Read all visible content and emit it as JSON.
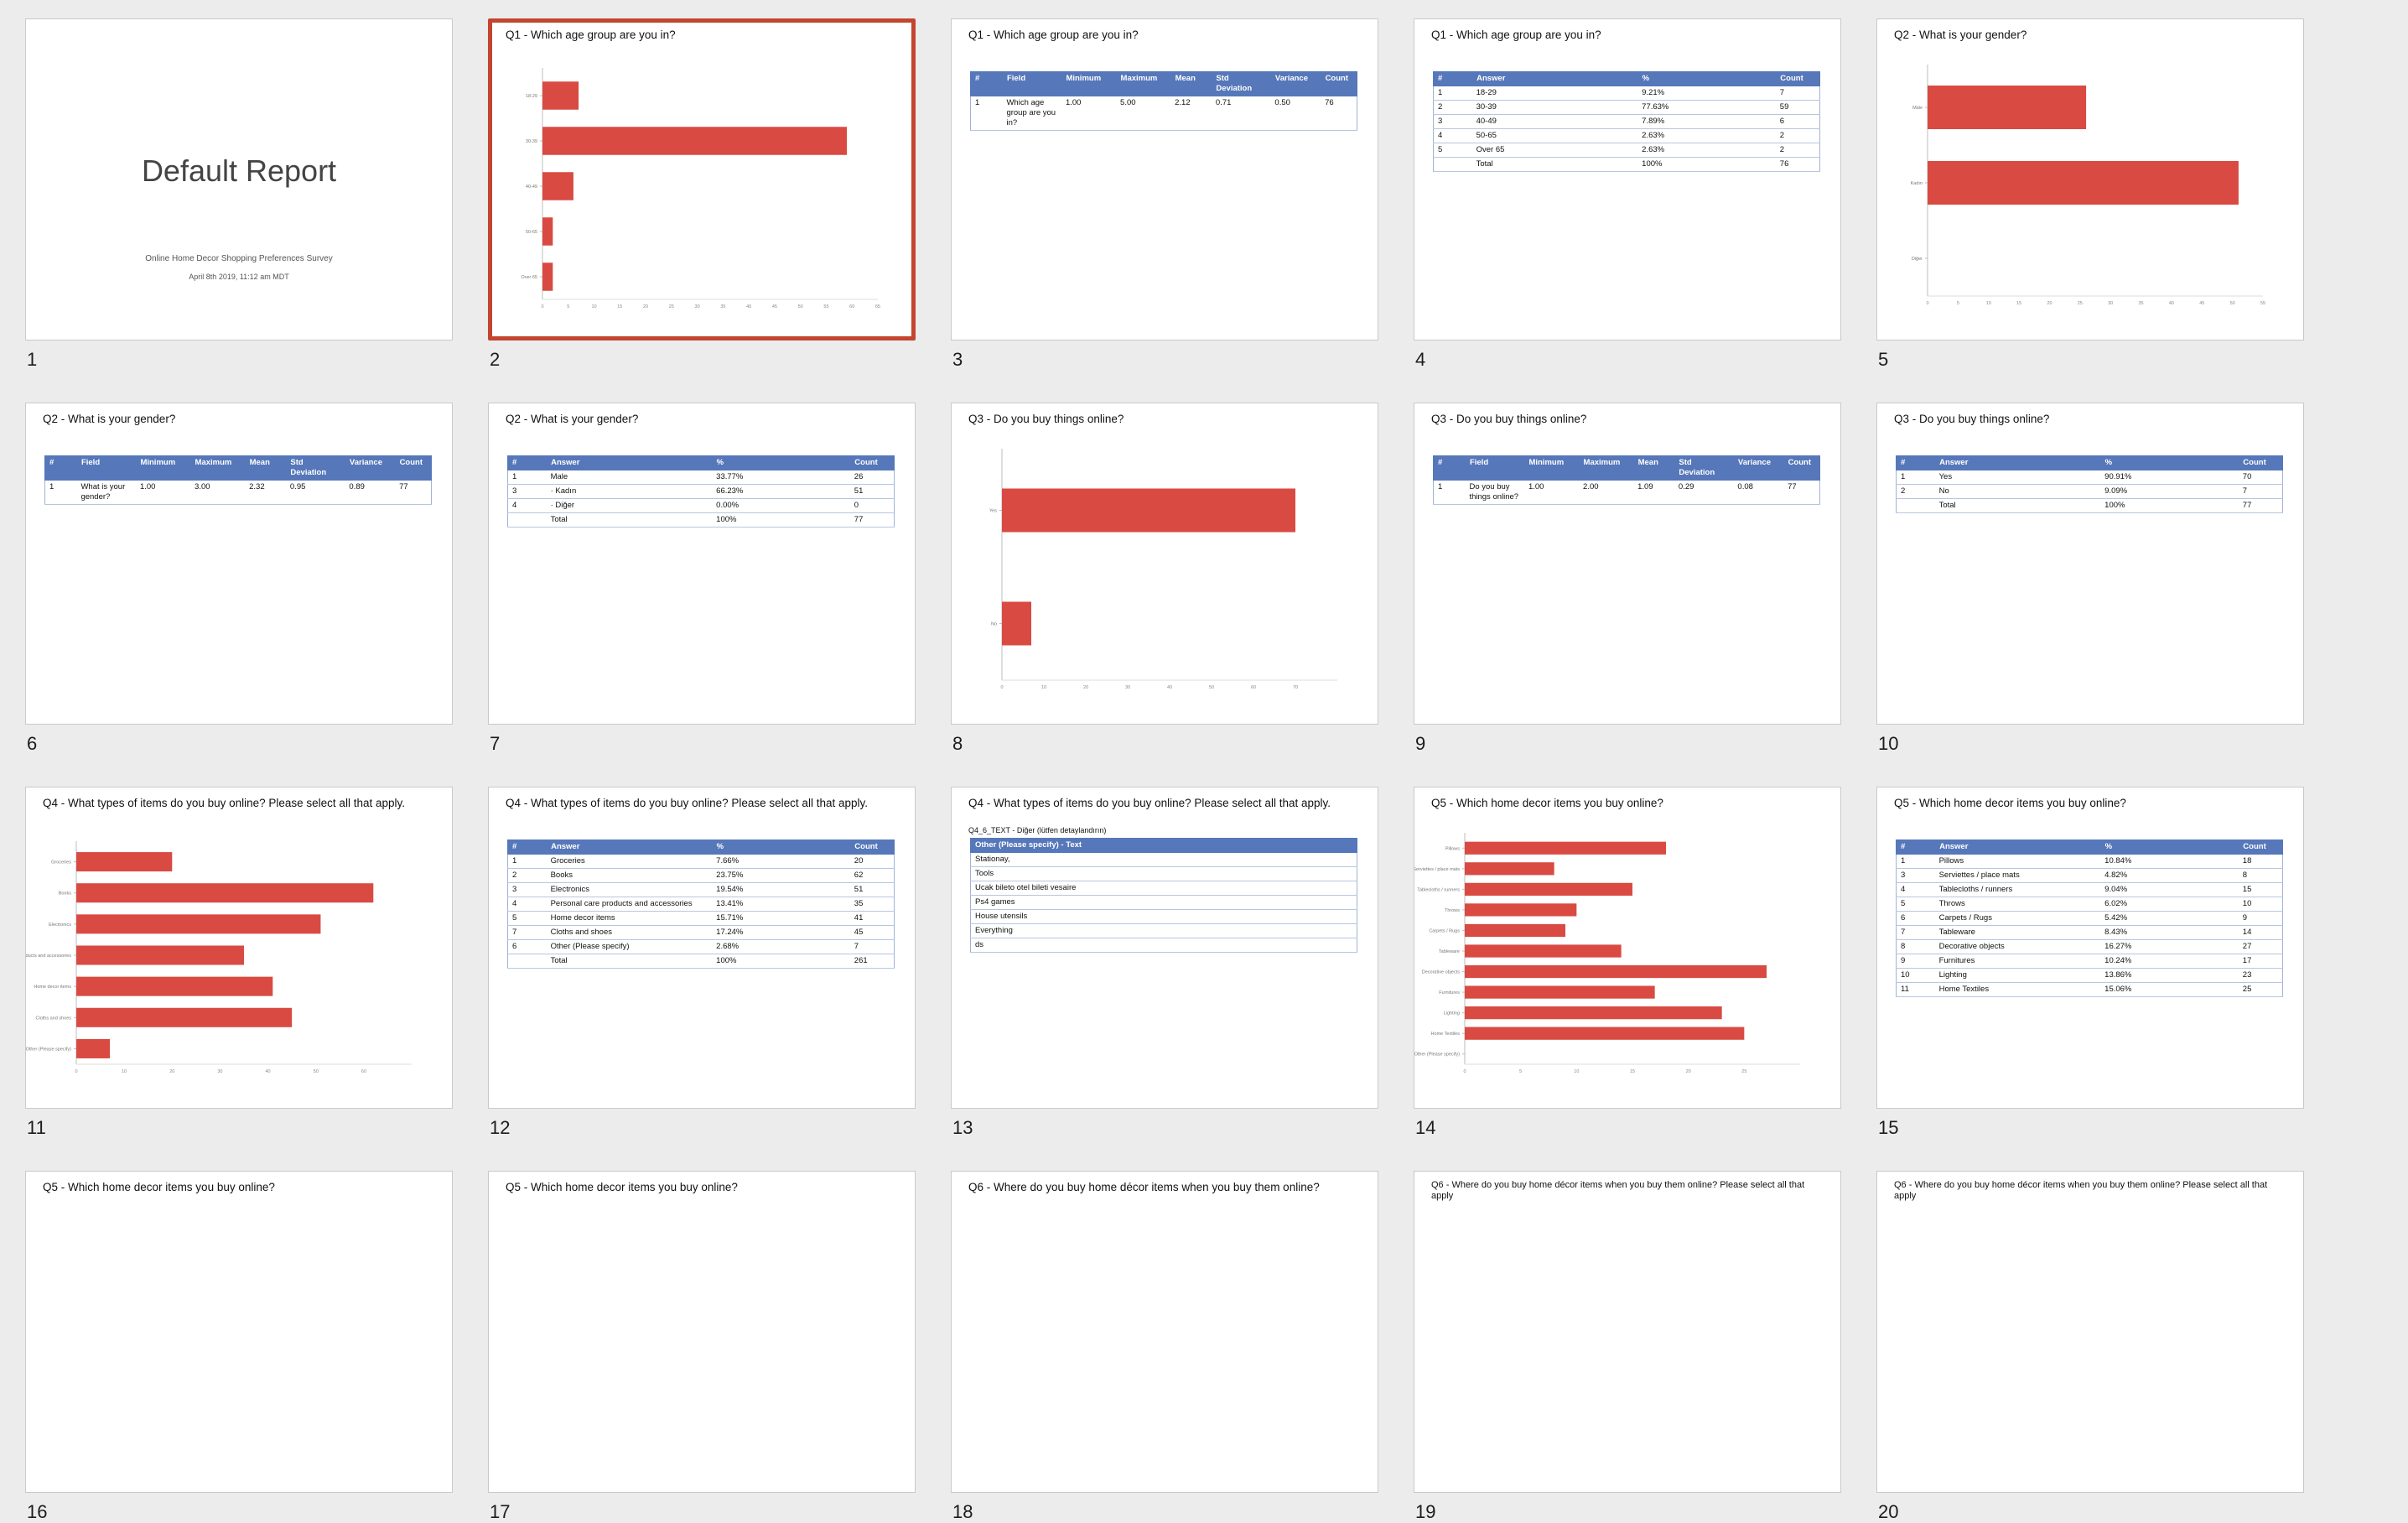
{
  "accent": "#c4452f",
  "table_header_color": "#5677b9",
  "bar_color": "#d94a42",
  "slides": [
    {
      "number": "1",
      "type": "cover",
      "title": "Default Report",
      "survey": "Online Home Decor Shopping Preferences Survey",
      "date": "April 8th 2019, 11:12 am MDT"
    },
    {
      "number": "2",
      "type": "chart",
      "selected": true,
      "title": "Q1 - Which age group are you in?",
      "chart_data": {
        "type": "bar",
        "orientation": "horizontal",
        "categories": [
          "18-29",
          "30-39",
          "40-49",
          "50-65",
          "Over 65"
        ],
        "values": [
          7,
          59,
          6,
          2,
          2
        ],
        "xlim": [
          0,
          65
        ],
        "ticks": [
          "0",
          "5",
          "10",
          "15",
          "20",
          "25",
          "30",
          "35",
          "40",
          "45",
          "50",
          "55",
          "60",
          "65"
        ]
      }
    },
    {
      "number": "3",
      "type": "table",
      "title": "Q1 - Which age group are you in?",
      "table": {
        "headers": [
          "#",
          "Field",
          "Minimum",
          "Maximum",
          "Mean",
          "Std Deviation",
          "Variance",
          "Count"
        ],
        "rows": [
          [
            "1",
            "Which age group are you in?",
            "1.00",
            "5.00",
            "2.12",
            "0.71",
            "0.50",
            "76"
          ]
        ]
      }
    },
    {
      "number": "4",
      "type": "table",
      "title": "Q1 - Which age group are you in?",
      "table": {
        "headers": [
          "#",
          "Answer",
          "%",
          "Count"
        ],
        "rows": [
          [
            "1",
            "18-29",
            "9.21%",
            "7"
          ],
          [
            "2",
            "30-39",
            "77.63%",
            "59"
          ],
          [
            "3",
            "40-49",
            "7.89%",
            "6"
          ],
          [
            "4",
            "50-65",
            "2.63%",
            "2"
          ],
          [
            "5",
            "Over 65",
            "2.63%",
            "2"
          ],
          [
            "",
            "Total",
            "100%",
            "76"
          ]
        ]
      }
    },
    {
      "number": "5",
      "type": "chart",
      "title": "Q2 - What is your gender?",
      "chart_data": {
        "type": "bar",
        "orientation": "horizontal",
        "categories": [
          "Male",
          "Kadın",
          "Diğer"
        ],
        "values": [
          26,
          51,
          0
        ],
        "xlim": [
          0,
          55
        ],
        "ticks": [
          "0",
          "5",
          "10",
          "15",
          "20",
          "25",
          "30",
          "35",
          "40",
          "45",
          "50",
          "55"
        ]
      }
    },
    {
      "number": "6",
      "type": "table",
      "title": "Q2 - What is your gender?",
      "table": {
        "headers": [
          "#",
          "Field",
          "Minimum",
          "Maximum",
          "Mean",
          "Std Deviation",
          "Variance",
          "Count"
        ],
        "rows": [
          [
            "1",
            "What is your gender?",
            "1.00",
            "3.00",
            "2.32",
            "0.95",
            "0.89",
            "77"
          ]
        ]
      }
    },
    {
      "number": "7",
      "type": "table",
      "title": "Q2 - What is your gender?",
      "table": {
        "headers": [
          "#",
          "Answer",
          "%",
          "Count"
        ],
        "rows": [
          [
            "1",
            "Male",
            "33.77%",
            "26"
          ],
          [
            "3",
            "· Kadın",
            "66.23%",
            "51"
          ],
          [
            "4",
            "· Diğer",
            "0.00%",
            "0"
          ],
          [
            "",
            "Total",
            "100%",
            "77"
          ]
        ]
      }
    },
    {
      "number": "8",
      "type": "chart",
      "title": "Q3 - Do you buy things online?",
      "chart_data": {
        "type": "bar",
        "orientation": "horizontal",
        "categories": [
          "Yes",
          "No"
        ],
        "values": [
          70,
          7
        ],
        "xlim": [
          0,
          80
        ],
        "ticks": [
          "0",
          "10",
          "20",
          "30",
          "40",
          "50",
          "60",
          "70"
        ]
      }
    },
    {
      "number": "9",
      "type": "table",
      "title": "Q3 - Do you buy things online?",
      "table": {
        "headers": [
          "#",
          "Field",
          "Minimum",
          "Maximum",
          "Mean",
          "Std Deviation",
          "Variance",
          "Count"
        ],
        "rows": [
          [
            "1",
            "Do you buy things online?",
            "1.00",
            "2.00",
            "1.09",
            "0.29",
            "0.08",
            "77"
          ]
        ]
      }
    },
    {
      "number": "10",
      "type": "table",
      "title": "Q3 - Do you buy things online?",
      "table": {
        "headers": [
          "#",
          "Answer",
          "%",
          "Count"
        ],
        "rows": [
          [
            "1",
            "Yes",
            "90.91%",
            "70"
          ],
          [
            "2",
            "No",
            "9.09%",
            "7"
          ],
          [
            "",
            "Total",
            "100%",
            "77"
          ]
        ]
      }
    },
    {
      "number": "11",
      "type": "chart",
      "title": "Q4 - What types of items do you buy online? Please select all that apply.",
      "chart_data": {
        "type": "bar",
        "orientation": "horizontal",
        "categories": [
          "Groceries",
          "Books",
          "Electronics",
          "Personal care products and accessories",
          "Home decor items",
          "Cloths and shoes",
          "Other (Please specify)"
        ],
        "values": [
          20,
          62,
          51,
          35,
          41,
          45,
          7
        ],
        "xlim": [
          0,
          70
        ],
        "ticks": [
          "0",
          "10",
          "20",
          "30",
          "40",
          "50",
          "60"
        ]
      }
    },
    {
      "number": "12",
      "type": "table",
      "title": "Q4 - What types of items do you buy online? Please select all that apply.",
      "table": {
        "headers": [
          "#",
          "Answer",
          "%",
          "Count"
        ],
        "rows": [
          [
            "1",
            "Groceries",
            "7.66%",
            "20"
          ],
          [
            "2",
            "Books",
            "23.75%",
            "62"
          ],
          [
            "3",
            "Electronics",
            "19.54%",
            "51"
          ],
          [
            "4",
            "Personal care products and accessories",
            "13.41%",
            "35"
          ],
          [
            "5",
            "Home decor items",
            "15.71%",
            "41"
          ],
          [
            "7",
            "Cloths and shoes",
            "17.24%",
            "45"
          ],
          [
            "6",
            "Other (Please specify)",
            "2.68%",
            "7"
          ],
          [
            "",
            "Total",
            "100%",
            "261"
          ]
        ]
      }
    },
    {
      "number": "13",
      "type": "text-table",
      "title": "Q4 - What types of items do you buy online? Please select all that apply.",
      "subtitle": "Q4_6_TEXT - Diğer (lütfen detaylandırın)",
      "table": {
        "headers": [
          "Other (Please specify) - Text"
        ],
        "rows": [
          [
            "Stationay,"
          ],
          [
            "Tools"
          ],
          [
            "Ucak bileto otel bileti vesaire"
          ],
          [
            "Ps4 games"
          ],
          [
            "House utensils"
          ],
          [
            "Everything"
          ],
          [
            "ds"
          ]
        ]
      }
    },
    {
      "number": "14",
      "type": "chart",
      "title": "Q5 - Which home decor items you buy online?",
      "chart_data": {
        "type": "bar",
        "orientation": "horizontal",
        "categories": [
          "Pillows",
          "Serviettes / place mats",
          "Tablecloths / runners",
          "Throws",
          "Carpets / Rugs",
          "Tableware",
          "Decorative objects",
          "Furnitures",
          "Lighting",
          "Home Textiles",
          "Other (Please specify)"
        ],
        "values": [
          18,
          8,
          15,
          10,
          9,
          14,
          27,
          17,
          23,
          25,
          0
        ],
        "xlim": [
          0,
          30
        ],
        "ticks": [
          "0",
          "5",
          "10",
          "15",
          "20",
          "25"
        ]
      }
    },
    {
      "number": "15",
      "type": "table",
      "title": "Q5 - Which home decor items you buy online?",
      "table": {
        "headers": [
          "#",
          "Answer",
          "%",
          "Count"
        ],
        "rows": [
          [
            "1",
            "Pillows",
            "10.84%",
            "18"
          ],
          [
            "3",
            "Serviettes / place mats",
            "4.82%",
            "8"
          ],
          [
            "4",
            "Tablecloths / runners",
            "9.04%",
            "15"
          ],
          [
            "5",
            "Throws",
            "6.02%",
            "10"
          ],
          [
            "6",
            "Carpets / Rugs",
            "5.42%",
            "9"
          ],
          [
            "7",
            "Tableware",
            "8.43%",
            "14"
          ],
          [
            "8",
            "Decorative objects",
            "16.27%",
            "27"
          ],
          [
            "9",
            "Furnitures",
            "10.24%",
            "17"
          ],
          [
            "10",
            "Lighting",
            "13.86%",
            "23"
          ],
          [
            "11",
            "Home Textiles",
            "15.06%",
            "25"
          ]
        ]
      }
    },
    {
      "number": "16",
      "type": "partial",
      "title": "Q5 - Which home decor items you buy online?"
    },
    {
      "number": "17",
      "type": "partial",
      "title": "Q5 - Which home decor items you buy online?"
    },
    {
      "number": "18",
      "type": "partial",
      "title": "Q6 - Where do you buy home décor items when you buy them online?"
    },
    {
      "number": "19",
      "type": "partial",
      "small": true,
      "title": "Q6 - Where do you buy home décor items when you buy them online? Please select all that apply"
    },
    {
      "number": "20",
      "type": "partial",
      "small": true,
      "title": "Q6 - Where do you buy home décor items when you buy them online? Please select all that apply"
    }
  ]
}
